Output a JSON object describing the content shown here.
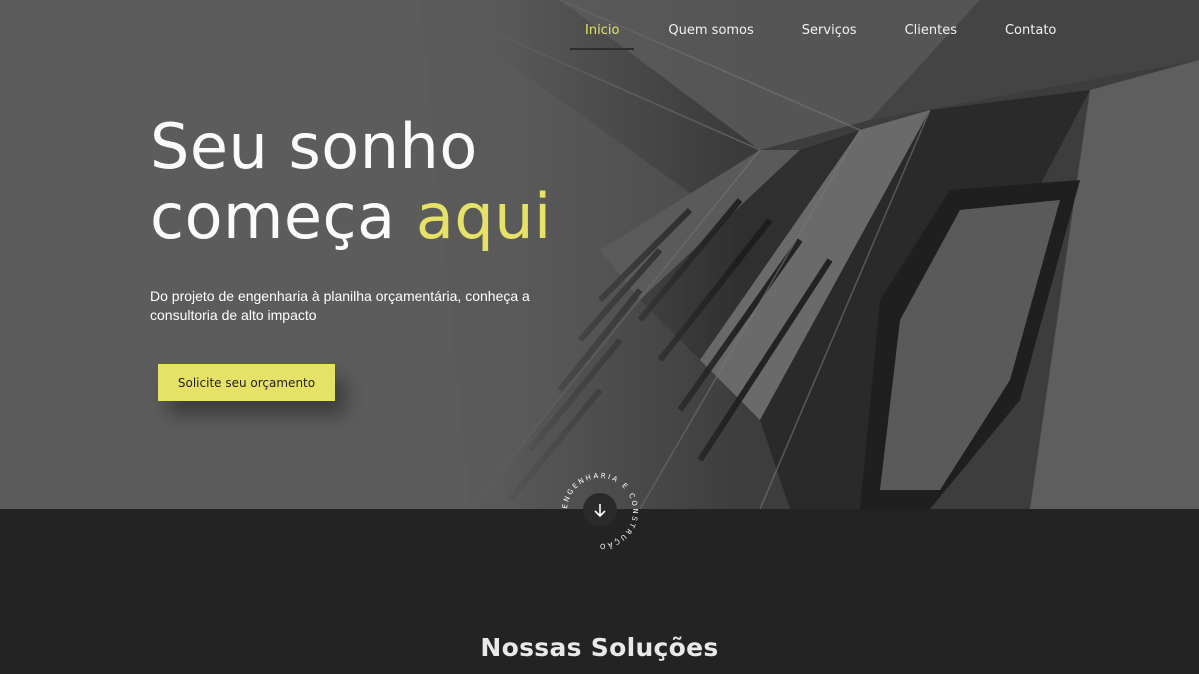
{
  "nav": {
    "items": [
      {
        "label": "Inicio",
        "active": true
      },
      {
        "label": "Quem somos",
        "active": false
      },
      {
        "label": "Serviços",
        "active": false
      },
      {
        "label": "Clientes",
        "active": false
      },
      {
        "label": "Contato",
        "active": false
      }
    ]
  },
  "hero": {
    "headline_line1": "Seu sonho",
    "headline_word2": "começa",
    "headline_accent": "aqui",
    "subtitle": "Do projeto de engenharia à planilha orçamentária, conheça a consultoria de alto impacto",
    "cta_label": "Solicite seu orçamento"
  },
  "badge": {
    "circular_text": "ENGENHARIA E CONSTRUÇÃO",
    "icon": "arrow-down-icon"
  },
  "solutions": {
    "title": "Nossas Soluções"
  },
  "colors": {
    "accent": "#e6e267",
    "dark_section": "#232323",
    "nav_text": "#f2f2f2"
  }
}
